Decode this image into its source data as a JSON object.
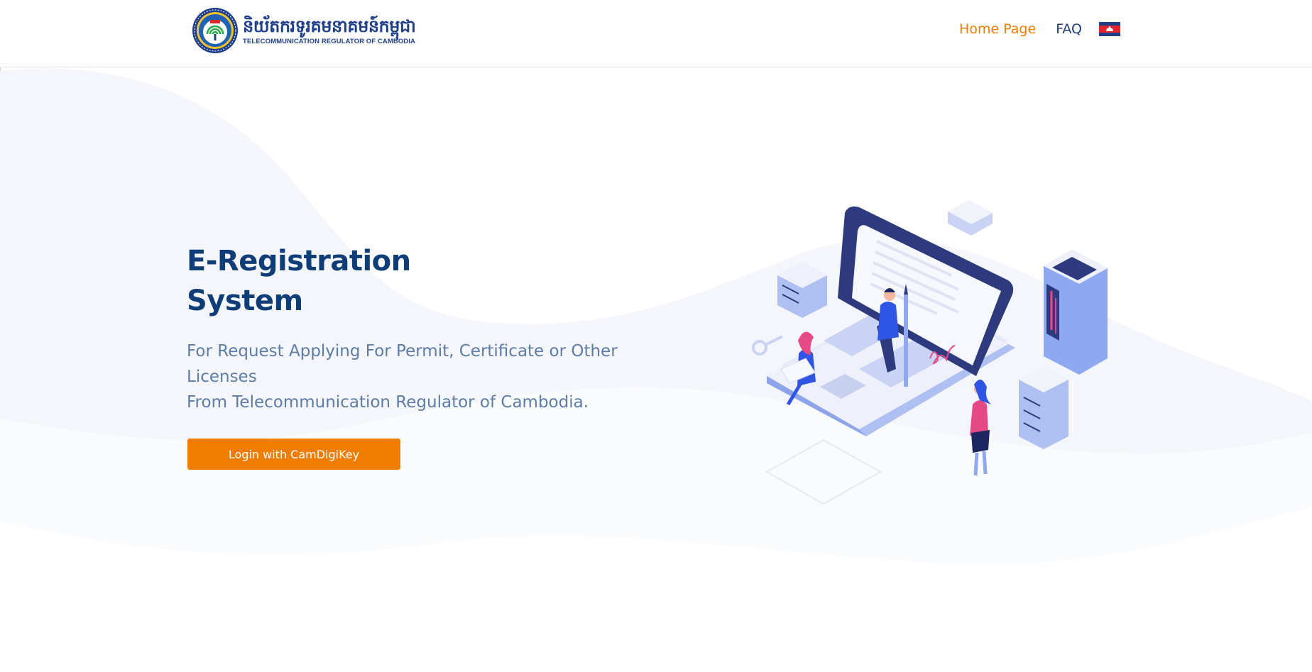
{
  "header": {
    "logo_khmer": "និយ័តករទូរគមនាគមន៍កម្ពុជា",
    "logo_english": "TELECOMMUNICATION REGULATOR OF CAMBODIA",
    "nav": {
      "home_label": "Home Page",
      "faq_label": "FAQ",
      "language_flag_icon": "cambodia-flag-icon"
    }
  },
  "hero": {
    "title_line1": "E-Registration",
    "title_line2": "System",
    "subtitle_line1": "For Request Applying For Permit, Certificate or Other Licenses",
    "subtitle_line2": "From Telecommunication Regulator of Cambodia.",
    "login_button": "Login with CamDigiKey"
  },
  "colors": {
    "accent_orange": "#f07c00",
    "title_navy": "#0f3d78",
    "subtitle_blue": "#5d7ca6",
    "nav_navy": "#1e3d7b"
  }
}
